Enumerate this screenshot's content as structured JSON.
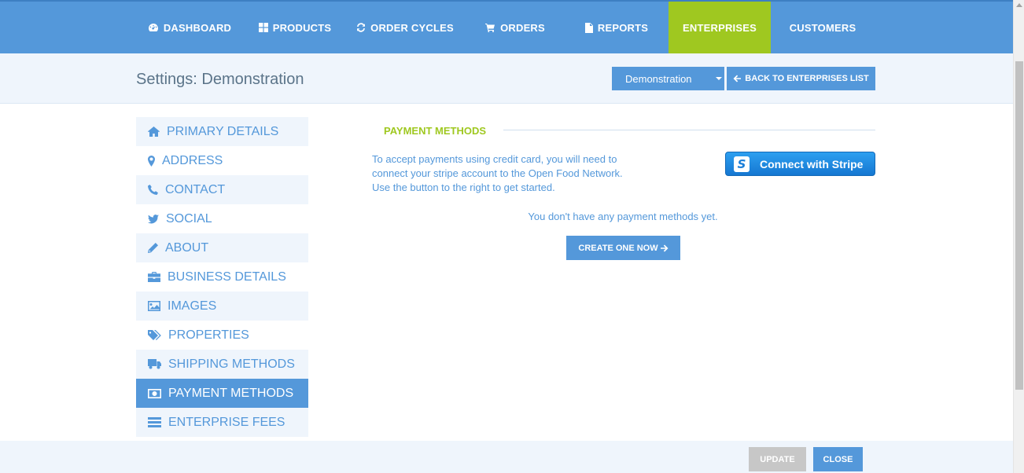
{
  "nav": {
    "dashboard": "DASHBOARD",
    "products": "PRODUCTS",
    "order_cycles": "ORDER CYCLES",
    "orders": "ORDERS",
    "reports": "REPORTS",
    "enterprises": "ENTERPRISES",
    "customers": "CUSTOMERS",
    "active": "ENTERPRISES"
  },
  "header": {
    "title": "Settings: Demonstration",
    "enterprise_select_value": "Demonstration",
    "back_label": "BACK TO ENTERPRISES LIST"
  },
  "sidebar": {
    "items": [
      {
        "label": "PRIMARY DETAILS",
        "icon": "home-icon"
      },
      {
        "label": "ADDRESS",
        "icon": "map-marker-icon"
      },
      {
        "label": "CONTACT",
        "icon": "phone-icon"
      },
      {
        "label": "SOCIAL",
        "icon": "twitter-icon"
      },
      {
        "label": "ABOUT",
        "icon": "pencil-icon"
      },
      {
        "label": "BUSINESS DETAILS",
        "icon": "briefcase-icon"
      },
      {
        "label": "IMAGES",
        "icon": "image-icon"
      },
      {
        "label": "PROPERTIES",
        "icon": "tags-icon"
      },
      {
        "label": "SHIPPING METHODS",
        "icon": "truck-icon"
      },
      {
        "label": "PAYMENT METHODS",
        "icon": "money-icon"
      },
      {
        "label": "ENTERPRISE FEES",
        "icon": "list-icon"
      }
    ],
    "active": "PAYMENT METHODS"
  },
  "main": {
    "section_title": "PAYMENT METHODS",
    "stripe_text_line1": "To accept payments using credit card, you will need to",
    "stripe_text_line2": "connect your stripe account to the Open Food Network.",
    "stripe_text_line3": "Use the button to the right to get started.",
    "stripe_button": "Connect with Stripe",
    "stripe_logo": "S",
    "empty_text": "You don't have any payment methods yet.",
    "create_label": "CREATE ONE NOW"
  },
  "footer": {
    "update_label": "UPDATE",
    "close_label": "CLOSE"
  },
  "colors": {
    "primary": "#5498da",
    "accent": "#9fc820",
    "light_band": "#eff5fc",
    "disabled": "#c7c7c7"
  }
}
